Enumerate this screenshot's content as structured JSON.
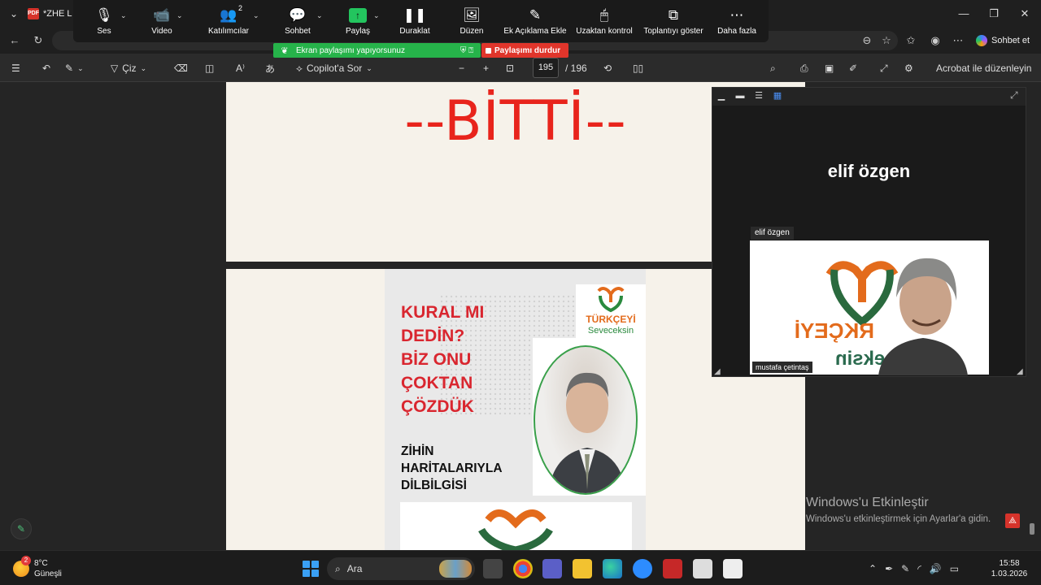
{
  "browser": {
    "tab_title": "*ZHE L",
    "sohbet_et": "Sohbet et"
  },
  "pdf_toolbar": {
    "ciz": "Çiz",
    "copilot": "Copilot'a Sor",
    "page_current": "195",
    "page_total": "/ 196",
    "acrobat": "Acrobat ile düzenleyin"
  },
  "zoom": {
    "buttons": [
      {
        "label": "Ses",
        "icon": "microphone-icon"
      },
      {
        "label": "Video",
        "icon": "video-camera-icon"
      },
      {
        "label": "Katılımcılar",
        "icon": "participants-icon"
      },
      {
        "label": "Sohbet",
        "icon": "chat-icon"
      },
      {
        "label": "Paylaş",
        "icon": "share-screen-icon"
      },
      {
        "label": "Duraklat",
        "icon": "pause-icon"
      },
      {
        "label": "Düzen",
        "icon": "annotate-icon"
      },
      {
        "label": "Ek Açıklama Ekle",
        "icon": "pencil-icon"
      },
      {
        "label": "Uzaktan kontrol",
        "icon": "mouse-icon"
      },
      {
        "label": "Toplantıyı göster",
        "icon": "show-meeting-icon"
      },
      {
        "label": "Daha fazla",
        "icon": "more-icon"
      }
    ],
    "participant_count": "2",
    "share_status": "Ekran paylaşımı yapıyorsunuz",
    "stop_share": "Paylaşımı durdur"
  },
  "document": {
    "page1_text": "--BİTTİ--",
    "flyer_headline": [
      "KURAL MI",
      "DEDİN?",
      "BİZ ONU",
      "ÇOKTAN",
      "ÇÖZDÜK"
    ],
    "flyer_subhead": [
      "ZİHİN",
      "HARİTALARIYLA",
      "DİLBİLGİSİ"
    ],
    "logo_top": "TÜRKÇEYİ",
    "logo_bottom": "Seveceksin"
  },
  "video_panel": {
    "host_name": "elif  özgen",
    "host_tag": "elif  özgen",
    "camera_name": "mustafa çetintaş",
    "cam_logo_top": "RKÇEYİ",
    "cam_logo_bottom": "eceksin"
  },
  "watermark": {
    "title": "Windows'u Etkinleştir",
    "subtitle": "Windows'u etkinleştirmek için Ayarlar'a gidin."
  },
  "taskbar": {
    "temperature": "8°C",
    "weather": "Güneşli",
    "weather_badge": "2",
    "search": "Ara",
    "time": "15:58",
    "date": "1.03.2026"
  }
}
